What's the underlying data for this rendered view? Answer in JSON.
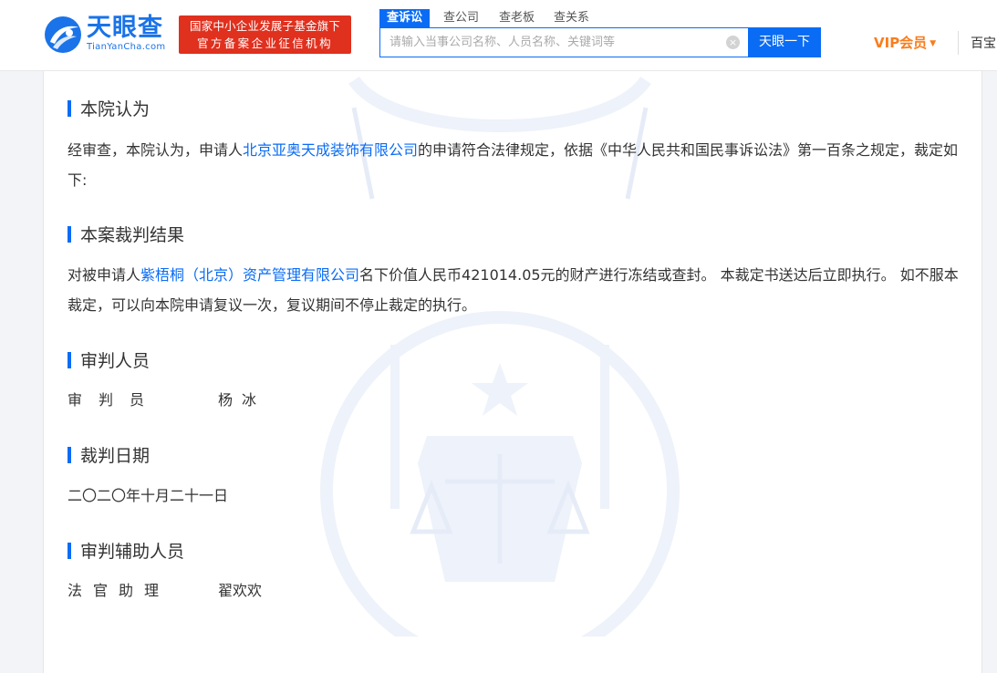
{
  "header": {
    "logo_text": "天眼查",
    "logo_sub": "TianYanCha.com",
    "badge_line1": "国家中小企业发展子基金旗下",
    "badge_line2": "官方备案企业征信机构",
    "tabs": [
      "查诉讼",
      "查公司",
      "查老板",
      "查关系"
    ],
    "search_placeholder": "请输入当事公司名称、人员名称、关键词等",
    "search_button": "天眼一下",
    "vip_label": "VIP会员",
    "vip_caret": "▼",
    "baobao_label": "百宝",
    "clear_icon": "×"
  },
  "sections": {
    "court_opinion": {
      "title": "本院认为",
      "text_before": "经审查，本院认为，申请人",
      "link": "北京亚奥天成装饰有限公司",
      "text_after": "的申请符合法律规定，依据《中华人民共和国民事诉讼法》第一百条之规定，裁定如下:"
    },
    "verdict": {
      "title": "本案裁判结果",
      "text_before": "对被申请人",
      "link": "紫梧桐（北京）资产管理有限公司",
      "text_after": "名下价值人民币421014.05元的财产进行冻结或查封。 本裁定书送达后立即执行。 如不服本裁定，可以向本院申请复议一次，复议期间不停止裁定的执行。"
    },
    "judges": {
      "title": "审判人员",
      "role": "审判员",
      "name": "杨冰"
    },
    "date": {
      "title": "裁判日期",
      "value": "二〇二〇年十月二十一日"
    },
    "assistants": {
      "title": "审判辅助人员",
      "role": "法官助理",
      "name": "翟欢欢"
    }
  },
  "colors": {
    "accent": "#0a6cf5",
    "badge_red": "#e0301e",
    "vip_orange": "#f97d1c"
  }
}
